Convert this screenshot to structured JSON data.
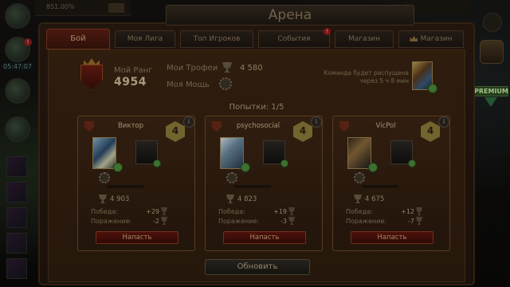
{
  "top_bar": {
    "resource": "851.00%"
  },
  "hud": {
    "time": "05:47:07",
    "premium": "PREMIUM"
  },
  "window": {
    "title": "Арена"
  },
  "tabs": [
    {
      "label": "Бой",
      "active": true
    },
    {
      "label": "Моя Лига"
    },
    {
      "label": "Топ Игроков"
    },
    {
      "label": "События",
      "alert": "!"
    },
    {
      "label": "Магазин"
    },
    {
      "label": "Магазин",
      "crown": true
    }
  ],
  "player": {
    "rank_label": "Мой Ранг",
    "rank_value": "4954",
    "trophies_label": "Мои Трофеи",
    "trophies_value": "4 580",
    "power_label": "Моя Мощь",
    "disband_note": "Команда будет распущена через 5 ч 8 мин"
  },
  "attempts": "Попытки: 1/5",
  "opponents": [
    {
      "name": "Виктор",
      "level": "4",
      "trophies": "4 903",
      "win_label": "Победа:",
      "win_value": "+29",
      "loss_label": "Поражение:",
      "loss_value": "-2",
      "attack": "Напасть"
    },
    {
      "name": "psychosocial",
      "level": "4",
      "trophies": "4 823",
      "win_label": "Победа:",
      "win_value": "+19",
      "loss_label": "Поражение:",
      "loss_value": "-3",
      "attack": "Напасть"
    },
    {
      "name": "VicPol",
      "level": "4",
      "trophies": "4 675",
      "win_label": "Победа:",
      "win_value": "+12",
      "loss_label": "Поражение:",
      "loss_value": "-7",
      "attack": "Напасть"
    }
  ],
  "refresh": "Обновить",
  "colors": {
    "accent": "#5e160e",
    "panel": "#2f1d0f",
    "gem": "#4a8a3a"
  }
}
